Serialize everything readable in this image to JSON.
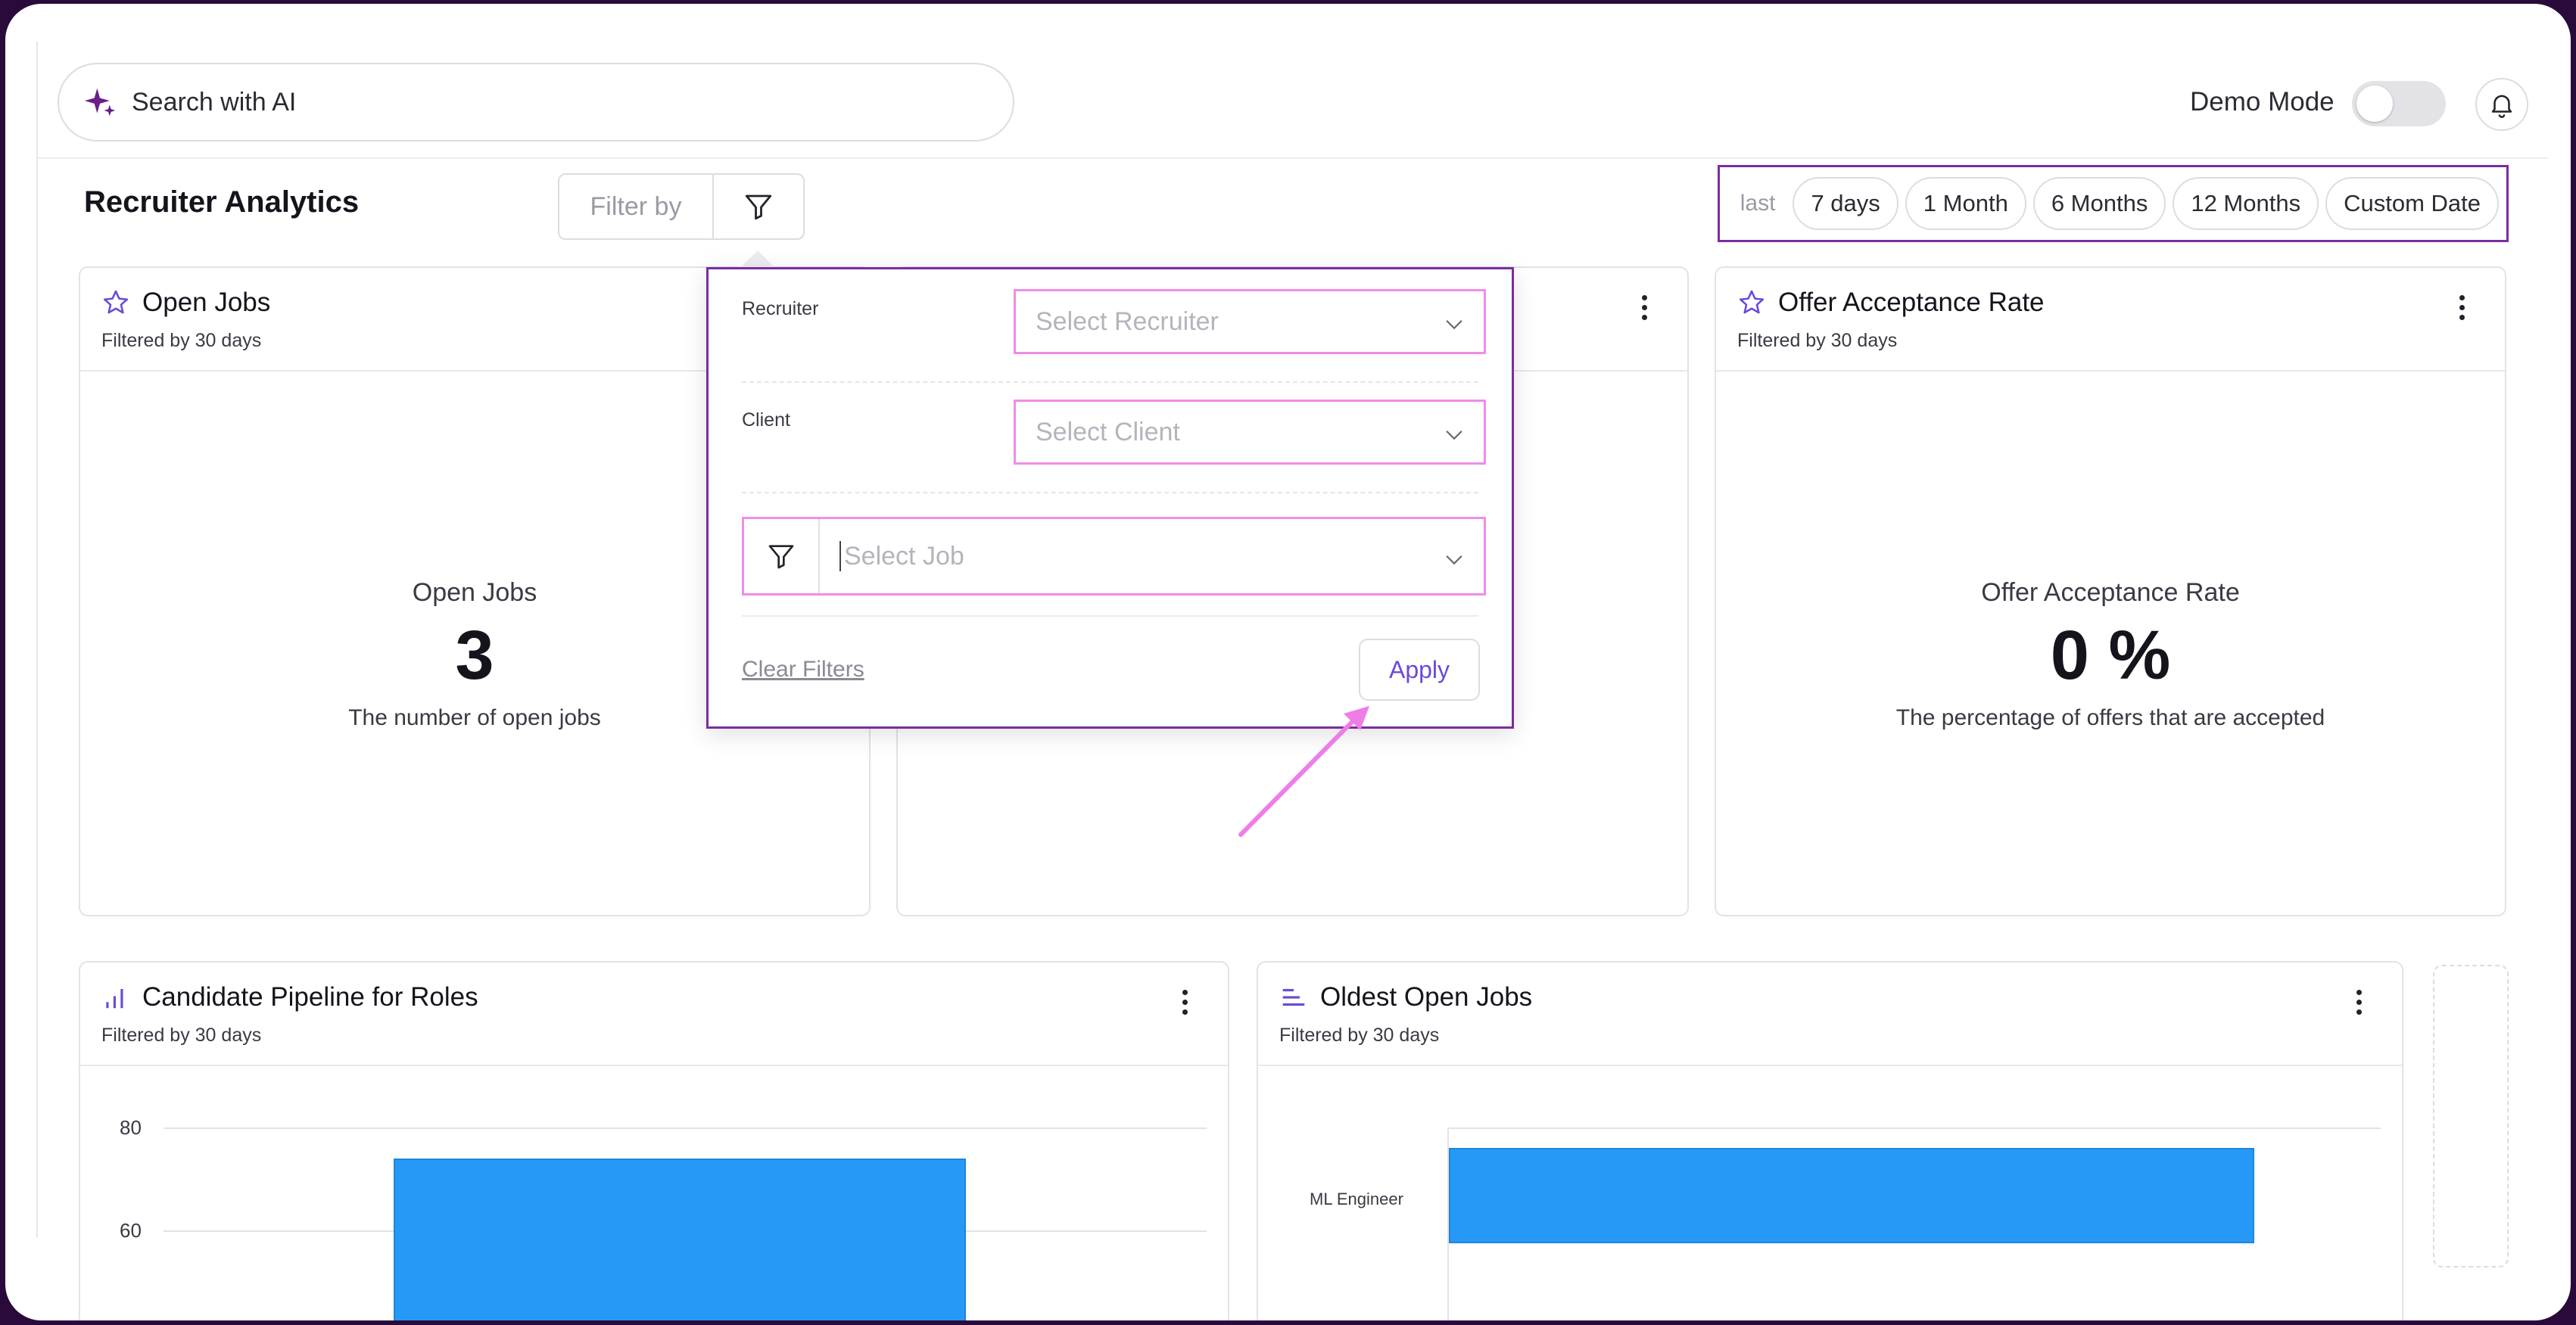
{
  "search": {
    "placeholder": "Search with AI",
    "icon": "sparkle-icon",
    "accent": "#7a2da0"
  },
  "header": {
    "demo_mode_label": "Demo Mode",
    "demo_mode_on": false,
    "notification_icon": "bell-icon"
  },
  "page": {
    "title": "Recruiter Analytics",
    "filter_by_label": "Filter by",
    "date_range": {
      "prefix": "last",
      "options": [
        "7 days",
        "1 Month",
        "6 Months",
        "12 Months",
        "Custom Date"
      ]
    }
  },
  "filter_popup": {
    "recruiter": {
      "label": "Recruiter",
      "placeholder": "Select Recruiter"
    },
    "client": {
      "label": "Client",
      "placeholder": "Select Client"
    },
    "job": {
      "placeholder": "Select Job"
    },
    "clear_label": "Clear Filters",
    "apply_label": "Apply"
  },
  "cards": {
    "open_jobs": {
      "title": "Open Jobs",
      "subtitle": "Filtered by 30 days",
      "metric_label": "Open Jobs",
      "value": "3",
      "description": "The number of open jobs"
    },
    "offer_acceptance": {
      "title": "Offer Acceptance Rate",
      "subtitle": "Filtered by 30 days",
      "metric_label": "Offer Acceptance Rate",
      "value": "0 %",
      "description": "The percentage of offers that are accepted"
    },
    "pipeline": {
      "title": "Candidate Pipeline for Roles",
      "subtitle": "Filtered by 30 days"
    },
    "oldest_jobs": {
      "title": "Oldest Open Jobs",
      "subtitle": "Filtered by 30 days"
    }
  },
  "colors": {
    "accent": "#7a2da0",
    "highlight": "#f08ce8",
    "bar": "#2699f6",
    "link": "#6a4ad8"
  },
  "chart_data": [
    {
      "type": "bar",
      "title": "Candidate Pipeline for Roles",
      "y_ticks": [
        "80",
        "60"
      ],
      "values": [
        74
      ],
      "ylim": [
        60,
        80
      ]
    },
    {
      "type": "bar",
      "orientation": "horizontal",
      "title": "Oldest Open Jobs",
      "categories": [
        "ML Engineer"
      ]
    }
  ]
}
